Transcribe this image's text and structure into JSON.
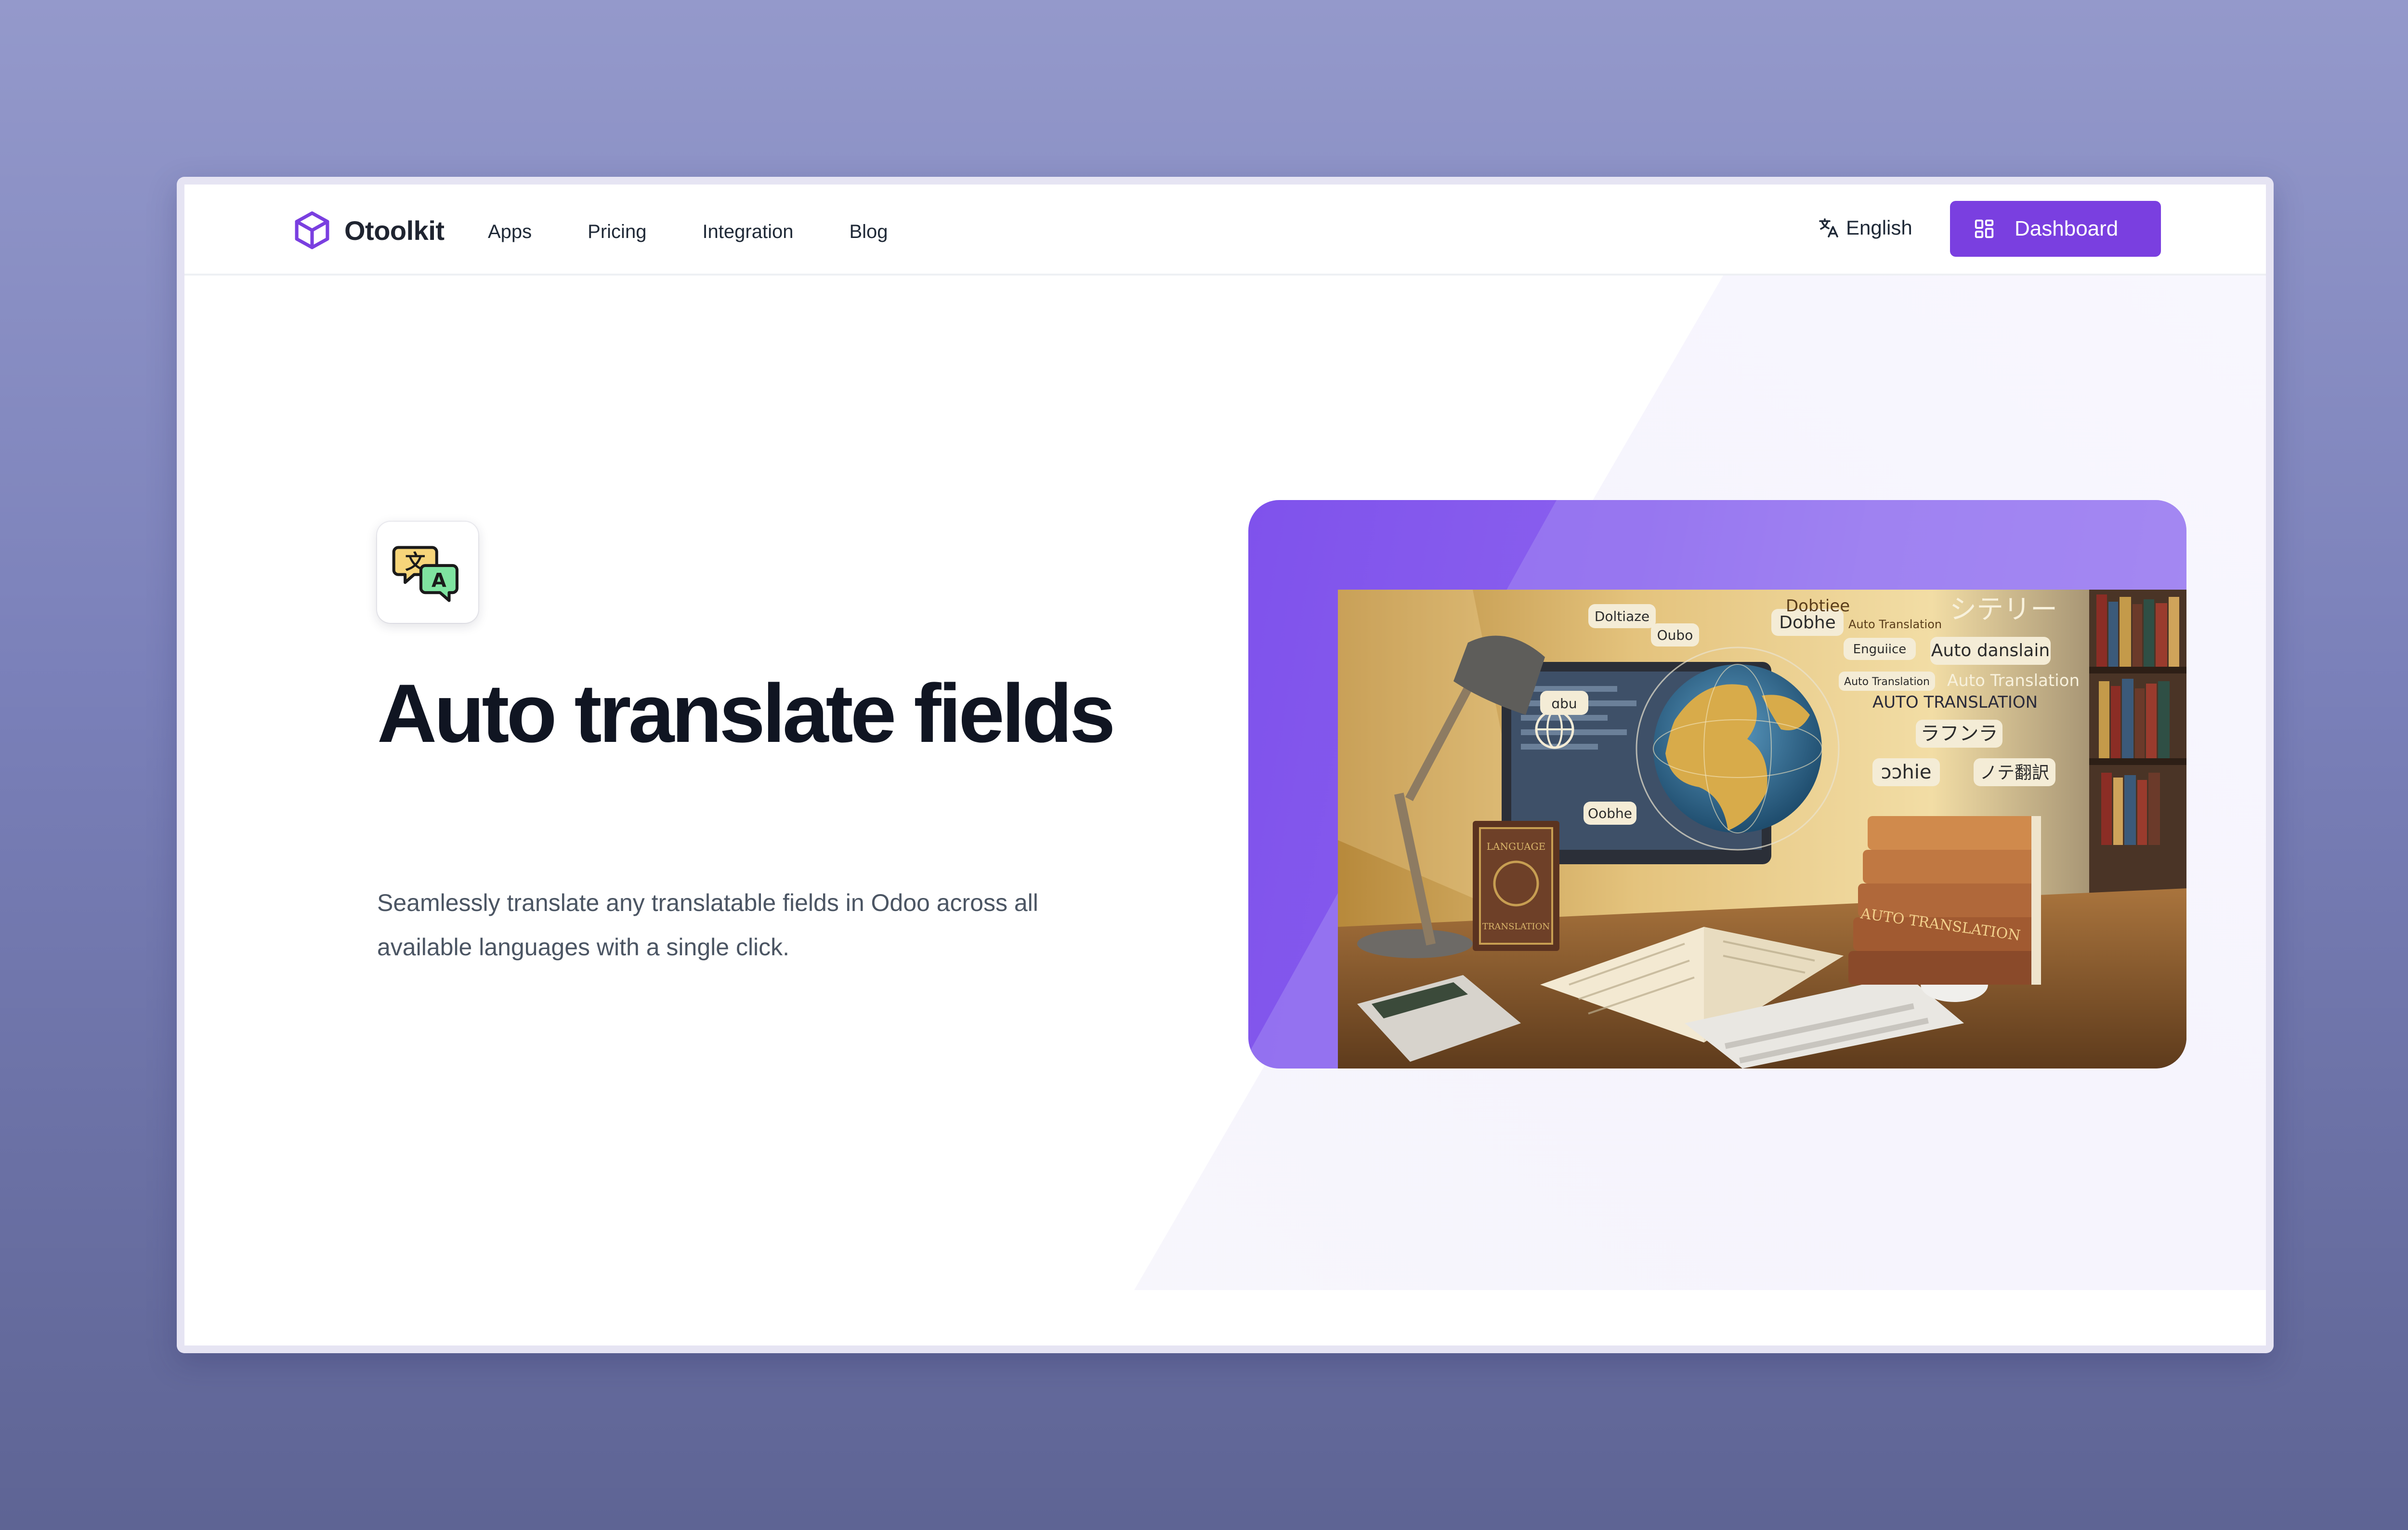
{
  "brand": {
    "name": "Otoolkit",
    "logo_icon": "cube-icon",
    "accent": "#7a3fe0"
  },
  "nav": {
    "items": [
      {
        "label": "Apps"
      },
      {
        "label": "Pricing"
      },
      {
        "label": "Integration"
      },
      {
        "label": "Blog"
      }
    ]
  },
  "header": {
    "language": {
      "label": "English",
      "icon": "translate-icon"
    },
    "dashboard": {
      "label": "Dashboard",
      "icon": "grid-icon"
    }
  },
  "hero": {
    "icon": "translate-chat-icon",
    "title": "Auto translate fields",
    "description": "Seamlessly translate any translatable fields in Odoo across all available languages with a single click.",
    "image_labels": {
      "bubble1": "Doltiaze",
      "bubble2": "Oubo",
      "bubble3": "Dobhe",
      "bubble4": "Dobtiee",
      "bubble5": "Auto Translation",
      "bubble6": "シテリー",
      "bubble7": "Enguiice",
      "bubble8": "Auto danslain",
      "bubble9": "Auto Translation",
      "bubble10": "Auto Translation",
      "bubble11": "AUTO TRANSLATION",
      "bubble12": "ラフンラ",
      "bubble13": "ɔɔhie",
      "bubble14": "ノテ翻訳",
      "bubble15": "Oobhe",
      "bubble16": "ɑbu",
      "book1": "LANGUAGE",
      "book2": "TRANSLATION",
      "book3": "AUTO TRANSLATION"
    }
  }
}
